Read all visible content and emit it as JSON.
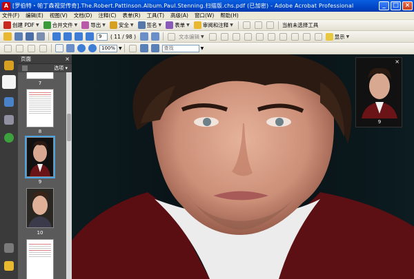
{
  "window": {
    "title": "[罗伯特・帕丁森视觉传奇].The.Robert.Pattinson.Album.Paul.Stenning.扫描版.chs.pdf (已加密) - Adobe Acrobat Professional"
  },
  "menu": {
    "items": [
      "文件(F)",
      "编辑(E)",
      "视图(V)",
      "文档(D)",
      "注释(C)",
      "表单(R)",
      "工具(T)",
      "高级(A)",
      "窗口(W)",
      "帮助(H)"
    ]
  },
  "toolbar1": {
    "create_pdf": "创建 PDF",
    "combine": "合并文件",
    "export": "导出",
    "security": "安全",
    "sign": "签名",
    "forms": "表单",
    "review": "审阅和注释",
    "current_tool": "当前未选择工具"
  },
  "toolbar2": {
    "page_number": "9",
    "page_total": "( 11 / 98 )",
    "text_edit": "文本编辑",
    "show": "显示"
  },
  "toolbar3": {
    "zoom": "100%",
    "find_placeholder": "查找"
  },
  "panel": {
    "title": "页面",
    "options": "选项",
    "thumbnails": [
      {
        "label": "7"
      },
      {
        "label": "8"
      },
      {
        "label": "9"
      },
      {
        "label": "10"
      },
      {
        "label": ""
      }
    ]
  },
  "mini_nav": {
    "label": "9"
  },
  "colors": {
    "title_blue": "#0047c8",
    "selection": "#4aa3df",
    "doc_background": "#0a1418"
  }
}
